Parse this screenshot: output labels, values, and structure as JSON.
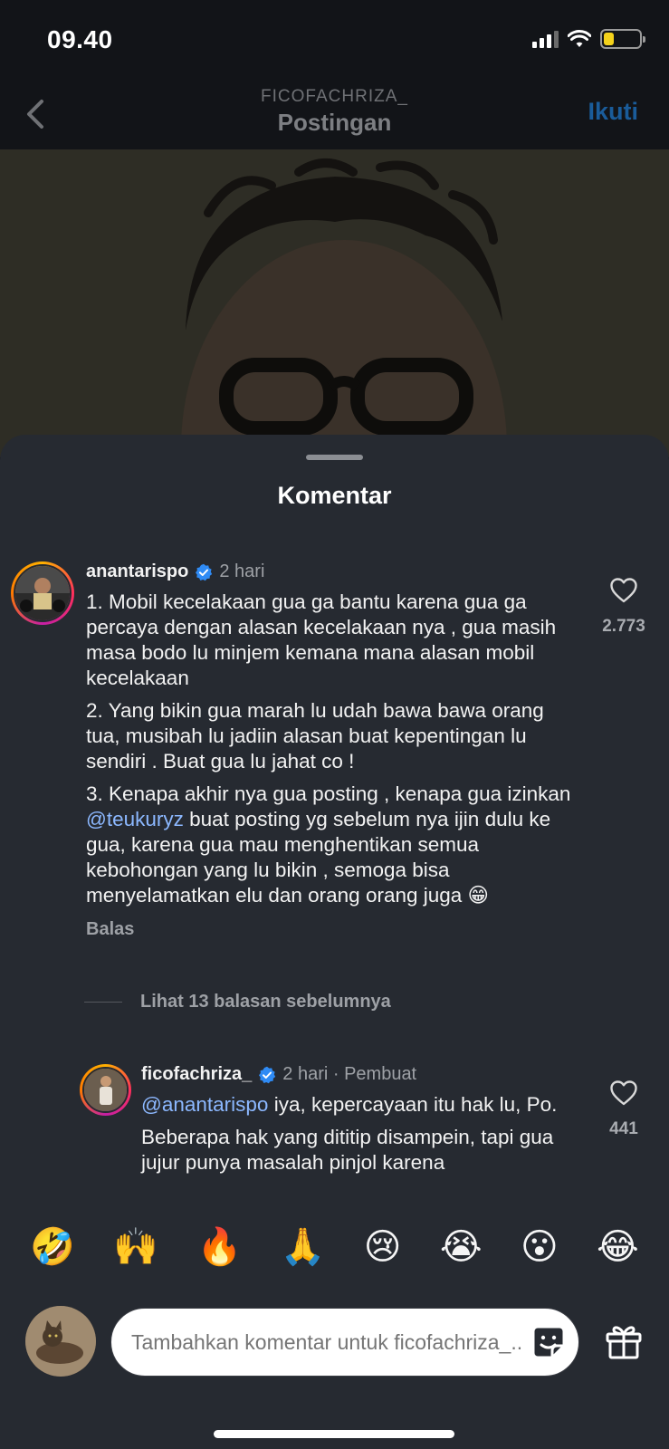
{
  "status_bar": {
    "time": "09.40",
    "battery_level": 0.28
  },
  "header": {
    "username": "FICOFACHRIZA_",
    "title": "Postingan",
    "follow_label": "Ikuti"
  },
  "sheet": {
    "title": "Komentar"
  },
  "comments": [
    {
      "username": "anantarispo",
      "verified": true,
      "time": "2 hari",
      "paragraphs": [
        "1. Mobil kecelakaan gua ga bantu karena gua ga percaya dengan alasan kecelakaan nya , gua masih masa bodo lu minjem kemana mana alasan mobil kecelakaan",
        "2. Yang bikin gua marah lu udah bawa bawa orang tua, musibah lu jadiin alasan buat kepentingan lu sendiri . Buat gua lu jahat co !"
      ],
      "p3_before": "3. Kenapa akhir nya gua posting , kenapa gua izinkan ",
      "p3_mention": "@teukuryz",
      "p3_after": " buat posting yg sebelum nya ijin dulu ke gua, karena gua mau menghentikan semua kebohongan yang lu bikin , semoga bisa menyelamatkan elu dan orang orang juga 😁",
      "reply_label": "Balas",
      "likes": "2.773"
    },
    {
      "username": "ficofachriza_",
      "verified": true,
      "time": "2 hari · Pembuat",
      "mention": "@anantarispo",
      "text_after_mention": " iya, kepercayaan itu hak lu, Po.",
      "paragraph2": "Beberapa hak yang dititip disampein, tapi gua jujur punya masalah pinjol karena",
      "likes": "441"
    }
  ],
  "view_replies": "Lihat 13 balasan sebelumnya",
  "emoji_bar": [
    "🤣",
    "🙌",
    "🔥",
    "🙏",
    "😢",
    "😭",
    "😮",
    "😂"
  ],
  "input": {
    "placeholder": "Tambahkan komentar untuk ficofachriza_..."
  },
  "icons": {
    "back": "chevron-left-icon",
    "verified": "verified-badge-icon",
    "like": "heart-outline-icon",
    "sticker": "sticker-icon",
    "gift": "gift-icon"
  },
  "colors": {
    "accent": "#1a5c9a",
    "mention": "#8cb8ff",
    "sheet_bg": "#262a31",
    "verified": "#2f8bf5"
  }
}
